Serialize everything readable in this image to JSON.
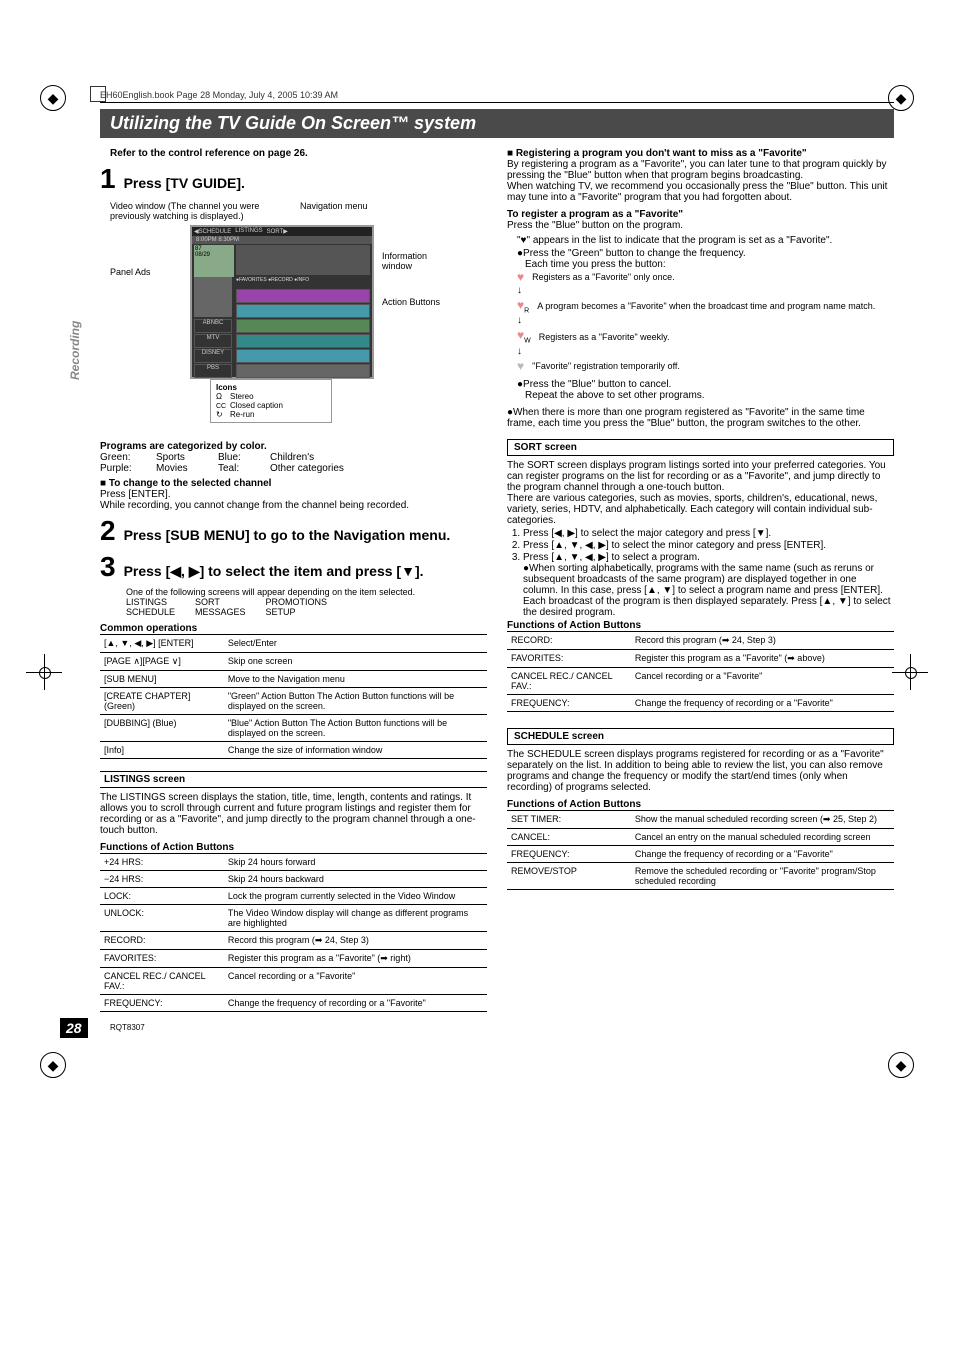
{
  "meta": {
    "book_header": "EH60English.book  Page 28  Monday, July 4, 2005  10:39 AM",
    "title": "Utilizing the TV Guide On Screen™ system",
    "side_tab": "Recording",
    "page_number": "28",
    "rqt": "RQT8307"
  },
  "left": {
    "ref_note": "Refer to the control reference on page 26.",
    "step1": "Press [TV GUIDE].",
    "diagram": {
      "video_window": "Video window (The channel you were previously watching is displayed.)",
      "panel_ads": "Panel Ads",
      "nav_menu": "Navigation menu",
      "info_window": "Information window",
      "action_buttons": "Action Buttons",
      "nav_items": [
        "SCHEDULE",
        "LISTINGS",
        "SORT"
      ],
      "time_row": "8:00PM            8:30PM",
      "misc_text": "87\n08/29       FAVORITES ●RECORD ●INFO"
    },
    "icons": {
      "heading": "Icons",
      "stereo": "Stereo",
      "cc": "Closed caption",
      "rerun": "Re-run"
    },
    "categories": {
      "heading": "Programs are categorized by color.",
      "rows": [
        [
          "Green:",
          "Sports",
          "Blue:",
          "Children's"
        ],
        [
          "Purple:",
          "Movies",
          "Teal:",
          "Other categories"
        ]
      ]
    },
    "change_channel": {
      "heading": "To change to the selected channel",
      "press": "Press [ENTER].",
      "note": "While recording, you cannot change from the channel being recorded."
    },
    "step2": "Press [SUB MENU] to go to the Navigation menu.",
    "step3": "Press [◀, ▶] to select the item and press [▼].",
    "step3_note": "One of the following screens will appear depending on the item selected.",
    "screens_left": [
      "LISTINGS",
      "SCHEDULE"
    ],
    "screens_mid": [
      "SORT",
      "MESSAGES"
    ],
    "screens_right": [
      "PROMOTIONS",
      "SETUP"
    ],
    "common_ops_heading": "Common operations",
    "common_ops": [
      [
        "[▲, ▼, ◀, ▶]\n[ENTER]",
        "Select/Enter"
      ],
      [
        "[PAGE ∧][PAGE ∨]",
        "Skip one screen"
      ],
      [
        "[SUB MENU]",
        "Move to the Navigation menu"
      ],
      [
        "[CREATE CHAPTER] (Green)",
        "\"Green\" Action Button\nThe Action Button functions will be displayed on the screen."
      ],
      [
        "[DUBBING] (Blue)",
        "\"Blue\" Action Button\nThe Action Button functions will be displayed on the screen."
      ],
      [
        "[Info]",
        "Change the size of information window"
      ]
    ],
    "listings_heading": "LISTINGS screen",
    "listings_intro": "The LISTINGS screen displays the station, title, time, length, contents and ratings. It allows you to scroll through current and future program listings and register them for recording or as a \"Favorite\", and jump directly to the program channel through a one-touch button.",
    "func_action_heading": "Functions of Action Buttons",
    "listings_actions": [
      [
        "+24 HRS:",
        "Skip 24 hours forward"
      ],
      [
        "−24 HRS:",
        "Skip 24 hours backward"
      ],
      [
        "LOCK:",
        "Lock the program currently selected in the Video Window"
      ],
      [
        "UNLOCK:",
        "The Video Window display will change as different programs are highlighted"
      ],
      [
        "RECORD:",
        "Record this program (➡ 24, Step 3)"
      ],
      [
        "FAVORITES:",
        "Register this program as a \"Favorite\" (➡ right)"
      ],
      [
        "CANCEL REC./ CANCEL FAV.:",
        "Cancel recording or a \"Favorite\""
      ],
      [
        "FREQUENCY:",
        "Change the frequency of recording or a \"Favorite\""
      ]
    ]
  },
  "right": {
    "fav_reg_heading": "Registering a program you don't want to miss as a \"Favorite\"",
    "fav_reg_intro": "By registering a program as a \"Favorite\", you can later tune to that program quickly by pressing the \"Blue\" button when that program begins broadcasting.\nWhen watching TV, we recommend you occasionally press the \"Blue\" button. This unit may tune into a \"Favorite\" program that you had forgotten about.",
    "to_register_heading": "To register a program as a \"Favorite\"",
    "to_register_press": "Press the \"Blue\" button on the program.",
    "fav_icon_note": "\"♥\" appears in the list to indicate that the program is set as a \"Favorite\".",
    "green_note": "●Press the \"Green\" button to change the frequency.",
    "each_time": "Each time you press the button:",
    "fav_rows": [
      "Registers as a \"Favorite\" only once.",
      "A program becomes a \"Favorite\" when the broadcast time and program name match.",
      "Registers as a \"Favorite\" weekly.",
      "\"Favorite\" registration temporarily off."
    ],
    "fav_icons_labels": [
      "",
      "R",
      "W",
      ""
    ],
    "blue_cancel": "●Press the \"Blue\" button to cancel.",
    "repeat": "Repeat the above to set other programs.",
    "multi_fav": "●When there is more than one program registered as \"Favorite\" in the same time frame, each time you press the \"Blue\" button, the program switches to the other.",
    "sort_heading": "SORT screen",
    "sort_intro1": "The SORT screen displays program listings sorted into your preferred categories. You can register programs on the list for recording or as a \"Favorite\", and jump directly to the program channel through a one-touch button.",
    "sort_intro2": "There are various categories, such as movies, sports, children's, educational, news, variety, series, HDTV, and alphabetically. Each category will contain individual sub-categories.",
    "sort_steps": [
      "Press [◀, ▶] to select the major category and press [▼].",
      "Press [▲, ▼, ◀, ▶] to select the minor category and press [ENTER].",
      "Press [▲, ▼, ◀, ▶] to select a program."
    ],
    "sort_substep": "●When sorting alphabetically, programs with the same name (such as reruns or subsequent broadcasts of the same program) are displayed together in one column. In this case, press [▲, ▼] to select a program name and press [ENTER]. Each broadcast of the program is then displayed separately. Press [▲, ▼] to select the desired program.",
    "sort_actions": [
      [
        "RECORD:",
        "Record this program (➡ 24, Step 3)"
      ],
      [
        "FAVORITES:",
        "Register this program as a \"Favorite\" (➡ above)"
      ],
      [
        "CANCEL REC./ CANCEL FAV.:",
        "Cancel recording or a \"Favorite\""
      ],
      [
        "FREQUENCY:",
        "Change the frequency of recording or a \"Favorite\""
      ]
    ],
    "schedule_heading": "SCHEDULE screen",
    "schedule_intro": "The SCHEDULE screen displays programs registered for recording or as a \"Favorite\" separately on the list. In addition to being able to review the list, you can also remove programs and change the frequency or modify the start/end times (only when recording) of programs selected.",
    "schedule_actions": [
      [
        "SET TIMER:",
        "Show the manual scheduled recording screen (➡ 25, Step 2)"
      ],
      [
        "CANCEL:",
        "Cancel an entry on the manual scheduled recording screen"
      ],
      [
        "FREQUENCY:",
        "Change the frequency of recording or a \"Favorite\""
      ],
      [
        "REMOVE/STOP",
        "Remove the scheduled recording or \"Favorite\" program/Stop scheduled recording"
      ]
    ]
  }
}
